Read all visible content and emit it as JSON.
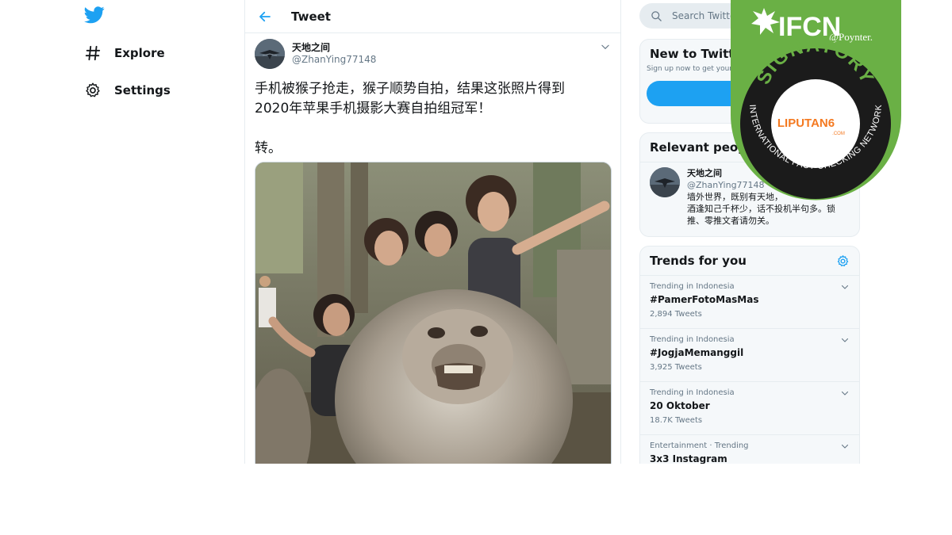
{
  "nav": {
    "items": [
      {
        "label": "Explore",
        "icon": "hashtag-icon"
      },
      {
        "label": "Settings",
        "icon": "gear-icon"
      }
    ]
  },
  "tweet": {
    "header_title": "Tweet",
    "author_name": "天地之间",
    "author_handle": "@ZhanYing77148",
    "text_line1": "手机被猴子抢走，猴子顺势自拍，结果这张照片得到",
    "text_line2": "2020年苹果手机摄影大赛自拍组冠军！",
    "text_line3": "转。"
  },
  "search": {
    "placeholder": "Search Twitter"
  },
  "new_to_twitter": {
    "title": "New to Twitter?",
    "subtitle": "Sign up now to get your own personalized timeline!"
  },
  "relevant_people": {
    "title": "Relevant people",
    "name": "天地之间",
    "handle": "@ZhanYing77148",
    "bio_line1": "墙外世界，既别有天地，",
    "bio_line2": "酒逢知己千杯少，话不投机半句多。锁",
    "bio_line3": "推、零推文者请勿关。"
  },
  "trends": {
    "title": "Trends for you",
    "items": [
      {
        "meta": "Trending in Indonesia",
        "name": "#PamerFotoMasMas",
        "count": "2,894 Tweets"
      },
      {
        "meta": "Trending in Indonesia",
        "name": "#JogjaMemanggil",
        "count": "3,925 Tweets"
      },
      {
        "meta": "Trending in Indonesia",
        "name": "20 Oktober",
        "count": "18.7K Tweets"
      },
      {
        "meta": "Entertainment · Trending",
        "name": "3x3 Instagram",
        "count": ""
      }
    ]
  },
  "badge": {
    "brand": "IFCN",
    "partner": "@Poynter.",
    "arc_text": "SIGNATORY",
    "network_text": "INTERNATIONAL FACT-CHECKING NETWORK",
    "center_logo": "LIPUTAN6",
    "center_logo_sub": ".COM"
  },
  "colors": {
    "twitter_blue": "#1da1f2",
    "badge_green": "#6ab045",
    "liputan_orange": "#f47920"
  }
}
